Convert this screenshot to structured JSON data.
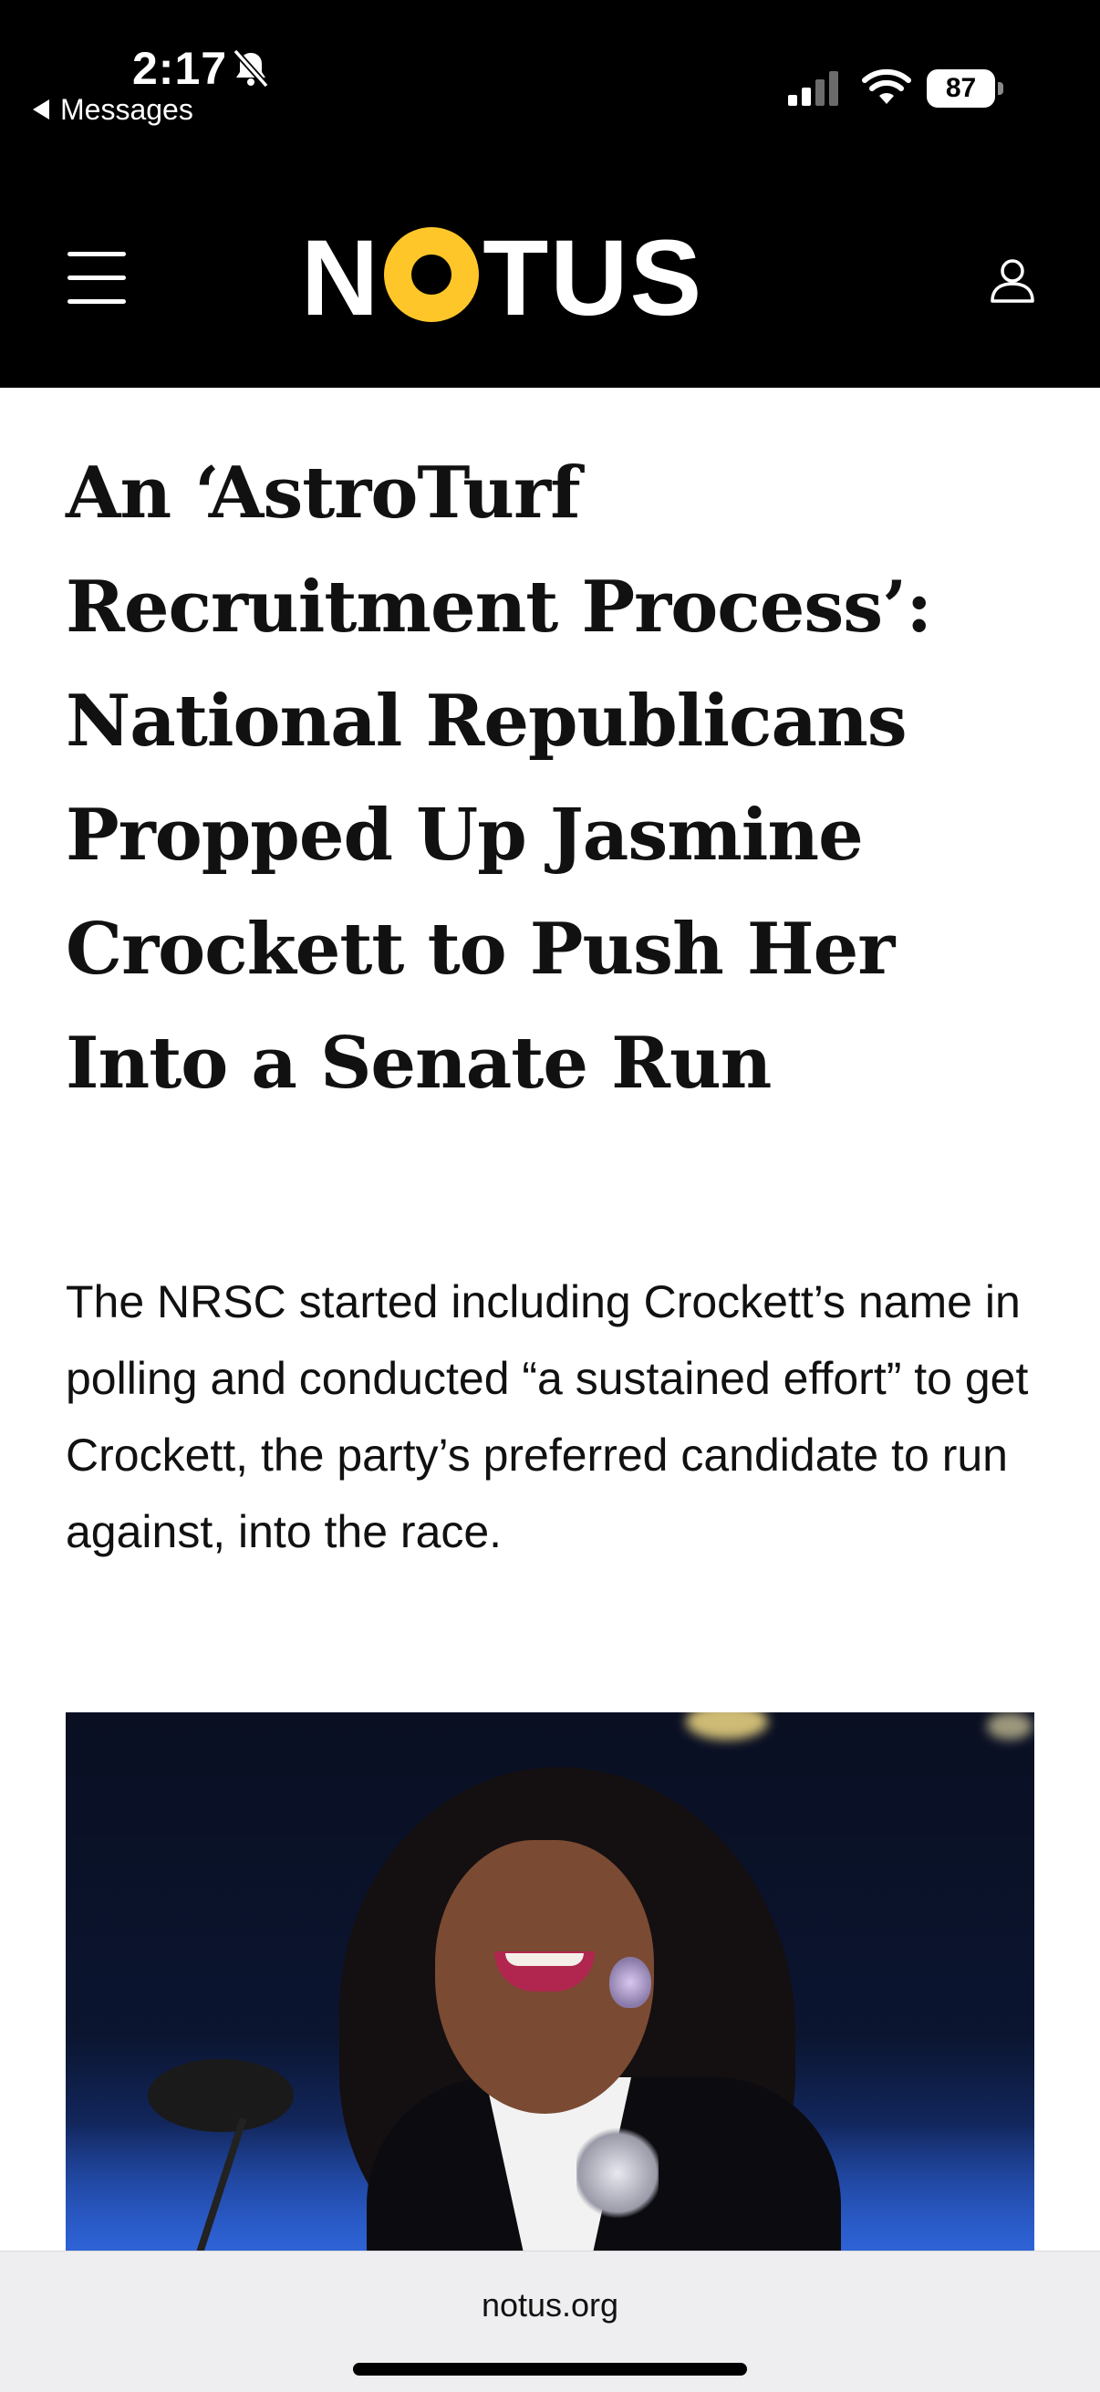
{
  "status_bar": {
    "time": "2:17",
    "back_label": "Messages",
    "battery": "87"
  },
  "header": {
    "logo_left": "N",
    "logo_right": "TUS",
    "accent_color": "#ffc629"
  },
  "article": {
    "headline": "An ‘AstroTurf Recruitment Process’: National Republicans Propped Up Jasmine Crockett to Push Her Into a Senate Run",
    "dek": "The NRSC started including Crockett’s name in polling and conducted “a sustained effort” to get Crockett, the party’s preferred candidate to run against, into the race."
  },
  "browser": {
    "url": "notus.org"
  },
  "icons": {
    "menu": "hamburger-menu-icon",
    "account": "user-account-icon",
    "silent": "bell-slash-icon",
    "signal": "cellular-signal-icon",
    "wifi": "wifi-icon"
  }
}
